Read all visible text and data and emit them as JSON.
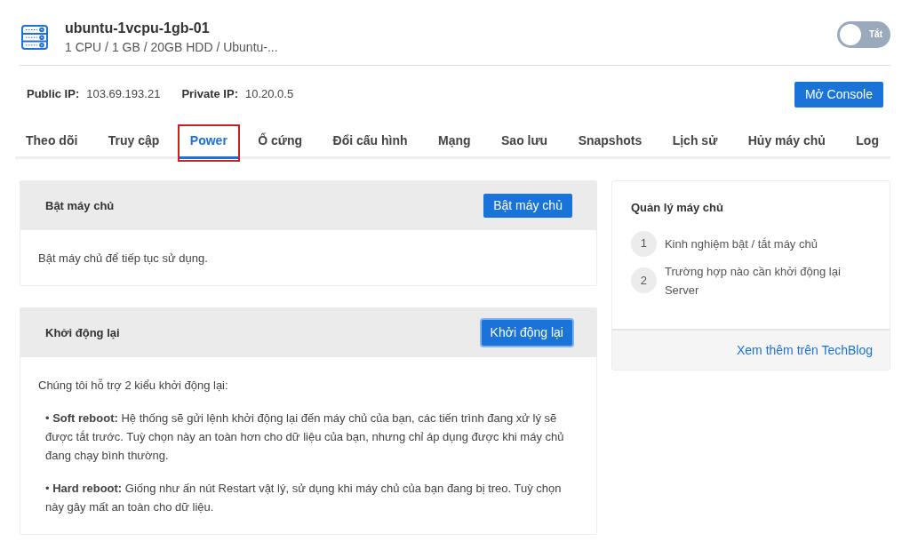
{
  "server": {
    "name": "ubuntu-1vcpu-1gb-01",
    "specs": "1 CPU / 1 GB / 20GB HDD / Ubuntu-...",
    "power_toggle": {
      "on": false,
      "label": "Tắt"
    }
  },
  "ips": [
    {
      "label": "Public IP:",
      "value": "103.69.193.21"
    },
    {
      "label": "Private IP:",
      "value": "10.20.0.5"
    }
  ],
  "console_button": "Mở Console",
  "tabs": [
    {
      "label": "Theo dõi",
      "selected": false
    },
    {
      "label": "Truy cập",
      "selected": false
    },
    {
      "label": "Power",
      "selected": true,
      "annotated": true
    },
    {
      "label": "Ổ cứng",
      "selected": false
    },
    {
      "label": "Đổi cấu hình",
      "selected": false
    },
    {
      "label": "Mạng",
      "selected": false
    },
    {
      "label": "Sao lưu",
      "selected": false
    },
    {
      "label": "Snapshots",
      "selected": false
    },
    {
      "label": "Lịch sử",
      "selected": false
    },
    {
      "label": "Hủy máy chủ",
      "selected": false
    },
    {
      "label": "Log",
      "selected": false
    }
  ],
  "panels": [
    {
      "title": "Bật máy chủ",
      "button": "Bật máy chủ",
      "focused": false,
      "paragraphs": [
        {
          "kind": "plain",
          "text": "Bật máy chủ để tiếp tục sử dụng."
        }
      ]
    },
    {
      "title": "Khởi động lại",
      "button": "Khởi động lại",
      "focused": true,
      "paragraphs": [
        {
          "kind": "plain",
          "text": "Chúng tôi hỗ trợ 2 kiểu khởi động lại:"
        },
        {
          "kind": "bullet",
          "text": "• **Soft reboot:** Hệ thống sẽ gửi lệnh khởi động lại đến máy chủ của bạn, các tiến trình đang xử lý sẽ được tắt trước. Tuỳ chọn này an toàn hơn cho dữ liệu của bạn, nhưng chỉ áp dụng được khi máy chủ đang chạy bình thường."
        },
        {
          "kind": "bullet",
          "text": "• **Hard reboot:** Giống như ấn nút Restart vật lý, sử dụng khi máy chủ của bạn đang bị treo. Tuỳ chọn này gây mất an toàn cho dữ liệu."
        }
      ]
    }
  ],
  "sidebar": {
    "title": "Quản lý máy chủ",
    "items": [
      {
        "number": "1",
        "text": "Kinh nghiệm bật / tắt máy chủ"
      },
      {
        "number": "2",
        "text": "Trường hợp nào cần khởi động lại Server"
      }
    ],
    "footer_link": "Xem thêm trên TechBlog"
  }
}
